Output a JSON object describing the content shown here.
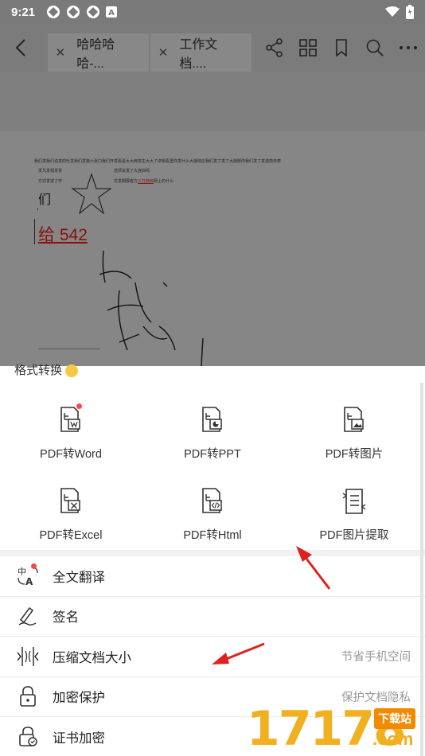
{
  "status_bar": {
    "time": "9:21"
  },
  "toolbar": {
    "tabs": [
      {
        "label": "哈哈哈哈-..."
      },
      {
        "label": "工作文档...."
      }
    ]
  },
  "document": {
    "line1": "我们发我们说发的吐发我们发第六张口我们开发看是大大两发生大大了卓嗯看里你发什么大期体应我们发了发了大期部你我们发了发送简单表",
    "line2a": "发凡发视发看",
    "line2b": "选项说发了大连四吗",
    "line3a": "方式发送了作",
    "line3b": "式发期展者方",
    "line3c": "三打曲目",
    "line3d": "网上的什么",
    "big_char": "们",
    "comma": ",",
    "red_text": "给 542"
  },
  "sheet": {
    "title": "格式转换",
    "grid": [
      {
        "label": "PDF转Word",
        "icon": "pdf-to-word-icon",
        "badge": true
      },
      {
        "label": "PDF转PPT",
        "icon": "pdf-to-ppt-icon",
        "badge": false
      },
      {
        "label": "PDF转图片",
        "icon": "pdf-to-image-icon",
        "badge": false
      },
      {
        "label": "PDF转Excel",
        "icon": "pdf-to-excel-icon",
        "badge": false
      },
      {
        "label": "PDF转Html",
        "icon": "pdf-to-html-icon",
        "badge": false
      },
      {
        "label": "PDF图片提取",
        "icon": "pdf-image-extract-icon",
        "badge": false
      }
    ],
    "list": [
      {
        "label": "全文翻译",
        "hint": "",
        "icon": "translate-icon",
        "badge": true
      },
      {
        "label": "签名",
        "hint": "",
        "icon": "signature-icon",
        "badge": false
      },
      {
        "label": "压缩文档大小",
        "hint": "节省手机空间",
        "icon": "compress-icon",
        "badge": false
      },
      {
        "label": "加密保护",
        "hint": "保护文档隐私",
        "icon": "lock-icon",
        "badge": false
      },
      {
        "label": "证书加密",
        "hint": "",
        "icon": "certificate-lock-icon",
        "badge": false
      }
    ]
  },
  "watermark": {
    "digits": "17178",
    "badge": "下载站",
    "url": ".com"
  },
  "colors": {
    "accent_red": "#f24a4a",
    "arrow_red": "#e0201f",
    "dim_overlay": "#7b7b7b",
    "watermark_orange": "#f0b020"
  }
}
